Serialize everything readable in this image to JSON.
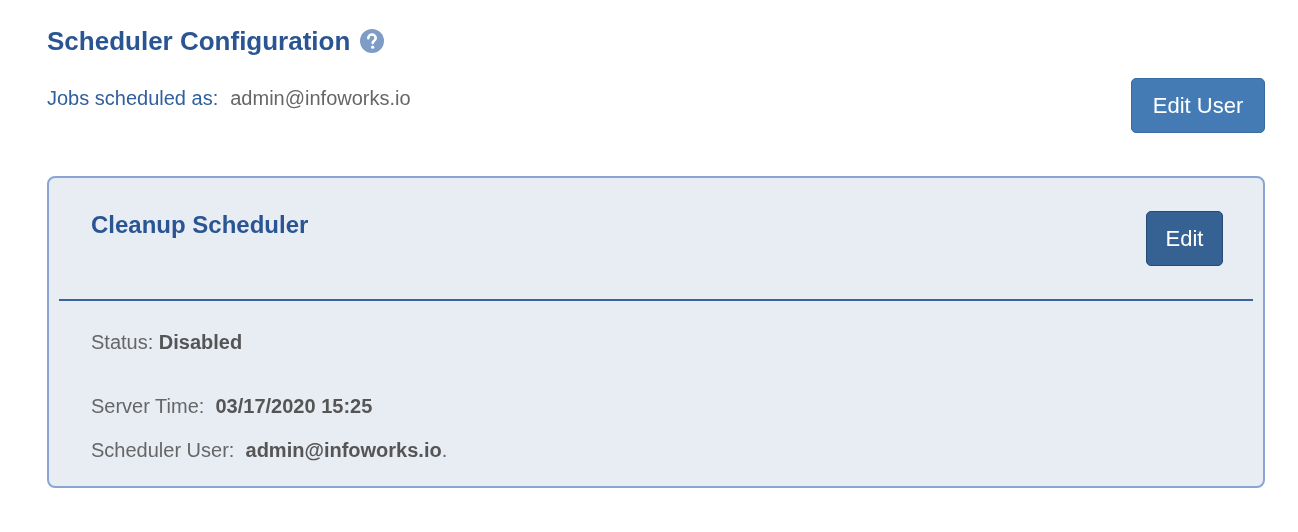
{
  "header": {
    "title": "Scheduler Configuration"
  },
  "jobs": {
    "label": "Jobs scheduled as:",
    "value": "admin@infoworks.io",
    "button": "Edit User"
  },
  "panel": {
    "title": "Cleanup Scheduler",
    "button": "Edit",
    "details": [
      {
        "text": "Status: **Disabled**"
      },
      {
        "text": "Server Time:  **03/17/2020 15:25**"
      },
      {
        "text": "Scheduler User:  **admin@infoworks.io**."
      }
    ]
  }
}
